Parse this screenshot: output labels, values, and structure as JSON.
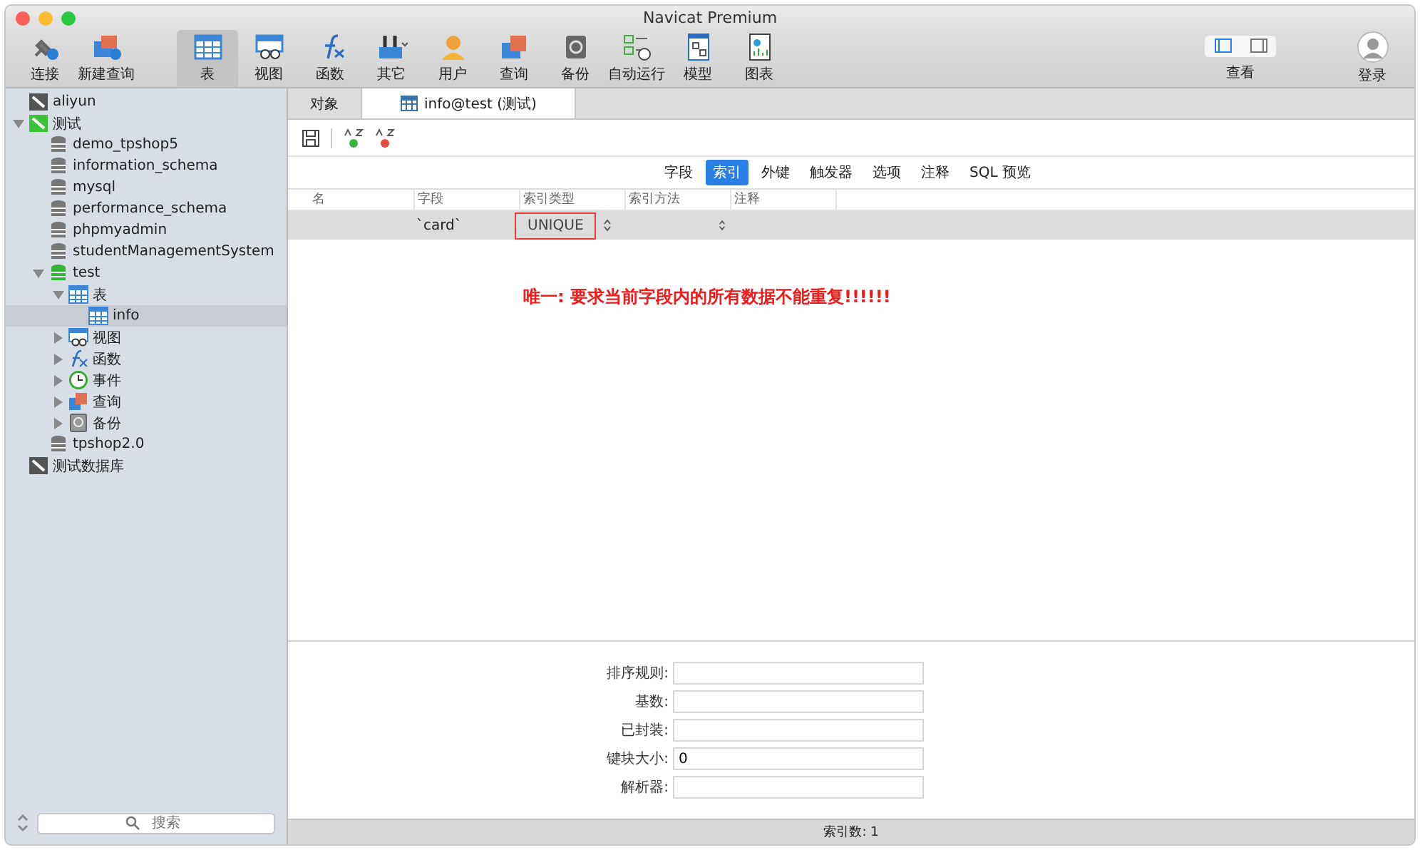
{
  "window": {
    "title": "Navicat Premium"
  },
  "toolbar": {
    "items": [
      {
        "label": "连接",
        "kind": "connect",
        "selected": false
      },
      {
        "label": "新建查询",
        "kind": "new-query",
        "selected": false
      },
      {
        "label": "表",
        "kind": "table",
        "selected": true
      },
      {
        "label": "视图",
        "kind": "view",
        "selected": false
      },
      {
        "label": "函数",
        "kind": "function",
        "selected": false
      },
      {
        "label": "其它",
        "kind": "other",
        "selected": false
      },
      {
        "label": "用户",
        "kind": "user",
        "selected": false
      },
      {
        "label": "查询",
        "kind": "query",
        "selected": false
      },
      {
        "label": "备份",
        "kind": "backup",
        "selected": false
      },
      {
        "label": "自动运行",
        "kind": "schedule",
        "selected": false
      },
      {
        "label": "模型",
        "kind": "model",
        "selected": false
      },
      {
        "label": "图表",
        "kind": "chart",
        "selected": false
      }
    ],
    "view": {
      "label": "查看",
      "panes": [
        {
          "kind": "left",
          "selected": true
        },
        {
          "kind": "right",
          "selected": false
        }
      ]
    },
    "login": {
      "label": "登录"
    }
  },
  "sidebar": {
    "tree": [
      {
        "label": "aliyun",
        "kind": "connection",
        "connected": false
      },
      {
        "label": "测试",
        "kind": "connection",
        "connected": true,
        "expanded": true,
        "children": [
          {
            "label": "demo_tpshop5",
            "kind": "database",
            "connected": false
          },
          {
            "label": "information_schema",
            "kind": "database",
            "connected": false
          },
          {
            "label": "mysql",
            "kind": "database",
            "connected": false
          },
          {
            "label": "performance_schema",
            "kind": "database",
            "connected": false
          },
          {
            "label": "phpmyadmin",
            "kind": "database",
            "connected": false
          },
          {
            "label": "studentManagementSystem",
            "kind": "database",
            "connected": false
          },
          {
            "label": "test",
            "kind": "database",
            "connected": true,
            "expanded": true,
            "children": [
              {
                "label": "表",
                "kind": "table",
                "expanded": true,
                "children": [
                  {
                    "label": "info",
                    "kind": "table",
                    "selected": true
                  }
                ]
              },
              {
                "label": "视图",
                "kind": "view",
                "expanded": false
              },
              {
                "label": "函数",
                "kind": "function",
                "expanded": false
              },
              {
                "label": "事件",
                "kind": "event",
                "expanded": false
              },
              {
                "label": "查询",
                "kind": "query",
                "expanded": false
              },
              {
                "label": "备份",
                "kind": "backup",
                "expanded": false
              }
            ]
          },
          {
            "label": "tpshop2.0",
            "kind": "database",
            "connected": false
          }
        ]
      },
      {
        "label": "测试数据库",
        "kind": "connection",
        "connected": false
      }
    ],
    "search": {
      "placeholder": "搜索"
    }
  },
  "doc_tabs": [
    {
      "label": "对象",
      "selected": false
    },
    {
      "label": "info@test (测试)",
      "selected": true
    }
  ],
  "sub_tabs": [
    {
      "label": "字段",
      "selected": false
    },
    {
      "label": "索引",
      "selected": true
    },
    {
      "label": "外键",
      "selected": false
    },
    {
      "label": "触发器",
      "selected": false
    },
    {
      "label": "选项",
      "selected": false
    },
    {
      "label": "注释",
      "selected": false
    },
    {
      "label": "SQL 预览",
      "selected": false
    }
  ],
  "table": {
    "columns": [
      "名",
      "字段",
      "索引类型",
      "索引方法",
      "注释"
    ],
    "rows": [
      {
        "field": "`card`",
        "index_type": "UNIQUE",
        "selected": true,
        "highlighted": true
      }
    ]
  },
  "annotation": "唯一: 要求当前字段内的所有数据不能重复!!!!!!",
  "properties": [
    {
      "label": "排序规则:"
    },
    {
      "label": "基数:"
    },
    {
      "label": "已封装:"
    },
    {
      "label": "键块大小:",
      "value": "0"
    },
    {
      "label": "解析器:"
    }
  ],
  "status_bar": "索引数: 1"
}
